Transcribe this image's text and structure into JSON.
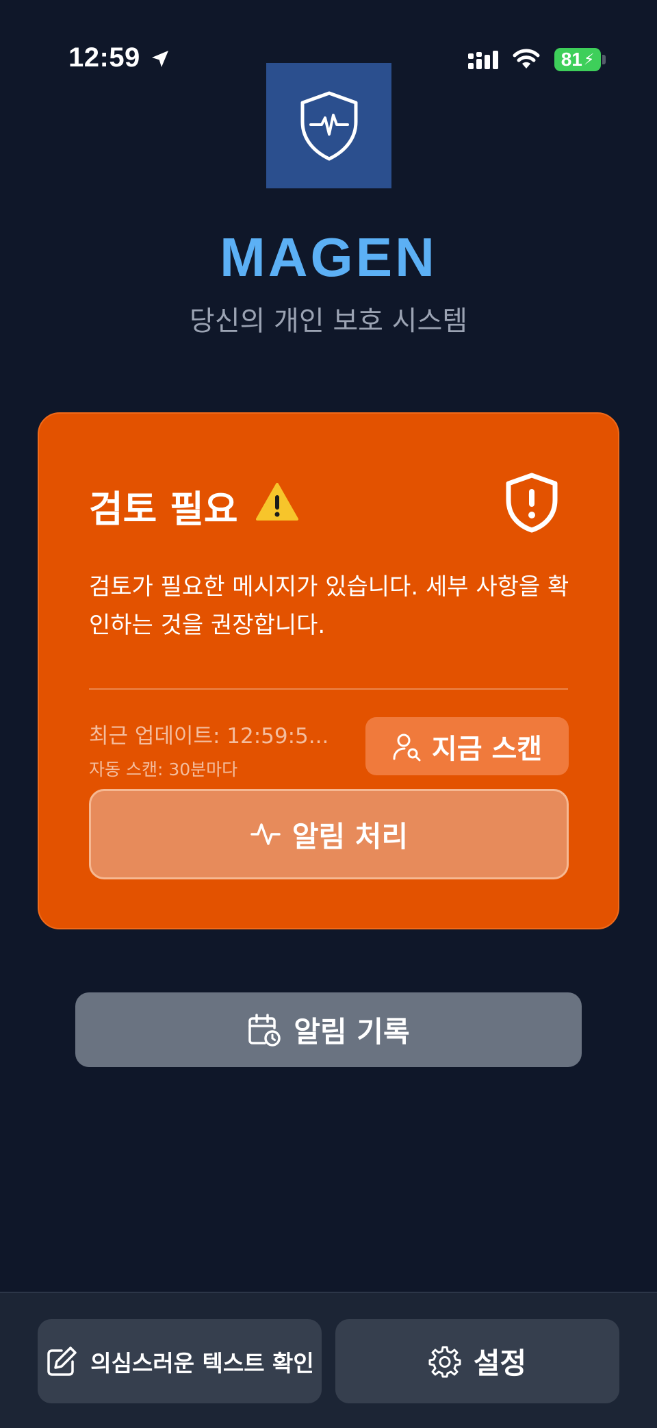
{
  "status_bar": {
    "time": "12:59",
    "battery_percent": "81",
    "icons": [
      "location-arrow-icon",
      "signal-icon",
      "wifi-icon",
      "battery-charging-icon"
    ]
  },
  "header": {
    "logo_icon": "shield-heartbeat-icon",
    "title": "MAGEN",
    "subtitle": "당신의 개인 보호 시스템"
  },
  "alert_card": {
    "title": "검토 필요",
    "warning_icon": "warning-icon",
    "status_icon": "shield-alert-icon",
    "message": "검토가 필요한 메시지가 있습니다. 세부 사항을 확인하는 것을 권장합니다.",
    "last_update": "최근 업데이트: 12:59:5...",
    "auto_scan": "자동 스캔: 30분마다",
    "scan_button_label": "지금 스캔",
    "handle_button_label": "알림 처리",
    "background_color": "#e35200"
  },
  "history_button_label": "알림 기록",
  "bottom_bar": {
    "check_text_label": "의심스러운 텍스트 확인",
    "settings_label": "설정"
  },
  "colors": {
    "background": "#0f1729",
    "accent": "#5cb0f5"
  }
}
